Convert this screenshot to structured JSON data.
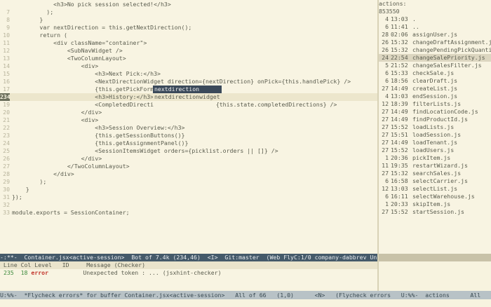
{
  "editor": {
    "lines": [
      {
        "n": "",
        "t": "            <h3>No pick session selected!</h3>"
      },
      {
        "n": "7",
        "t": "          );"
      },
      {
        "n": "8",
        "t": "        }"
      },
      {
        "n": "9",
        "t": "        var nextDirection = this.getNextDirection();"
      },
      {
        "n": "10",
        "t": "        return ("
      },
      {
        "n": "11",
        "t": "            <div className=\"container\">"
      },
      {
        "n": "12",
        "t": "                <SubNavWidget />"
      },
      {
        "n": "13",
        "t": "                <TwoColumnLayout>"
      },
      {
        "n": "14",
        "t": "                    <div>"
      },
      {
        "n": "15",
        "t": "                        <h3>Next Pick:</h3>"
      },
      {
        "n": "16",
        "t": "                        <NextDirectionWidget direction={nextDirection} onPick={this.handlePick} />"
      },
      {
        "n": "17",
        "t": "                        {this.getPickForm(next)"
      },
      {
        "n": "234",
        "t": "                        <h3>History:</h3> next"
      },
      {
        "n": "19",
        "t": "                        <CompletedDirecti                  {this.state.completedDirections} />"
      },
      {
        "n": "20",
        "t": "                    </div>"
      },
      {
        "n": "21",
        "t": "                    <div>"
      },
      {
        "n": "22",
        "t": "                        <h3>Session Overview:</h3>"
      },
      {
        "n": "23",
        "t": "                        {this.getSessionButtons()}"
      },
      {
        "n": "24",
        "t": "                        {this.getAssignmentPanel()}"
      },
      {
        "n": "25",
        "t": "                        <SessionItemsWidget orders={picklist.orders || []} />"
      },
      {
        "n": "26",
        "t": "                    </div>"
      },
      {
        "n": "27",
        "t": "                </TwoColumnLayout>"
      },
      {
        "n": "28",
        "t": "            </div>"
      },
      {
        "n": "29",
        "t": "        );"
      },
      {
        "n": "30",
        "t": "    }"
      },
      {
        "n": "31",
        "t": "});"
      },
      {
        "n": "32",
        "t": ""
      },
      {
        "n": "33",
        "t": "module.exports = SessionContainer;"
      }
    ],
    "current_line": "234"
  },
  "completion": {
    "items": [
      "nextdirection",
      "nextdirectionwidget"
    ],
    "selected": 0
  },
  "sidebar": {
    "header": "actions:",
    "total": "853550",
    "files": [
      {
        "size": "4",
        "time": "13:03",
        "name": "."
      },
      {
        "size": "6",
        "time": "11:41",
        "name": ".."
      },
      {
        "size": "28",
        "time": "02:06",
        "name": "assignUser.js"
      },
      {
        "size": "26",
        "time": "15:32",
        "name": "changeDraftAssignment.js"
      },
      {
        "size": "26",
        "time": "15:32",
        "name": "changePendingPickQuantity.js"
      },
      {
        "size": "24",
        "time": "22:54",
        "name": "changeSalePriority.js"
      },
      {
        "size": "5",
        "time": "21:52",
        "name": "changeSalesFilter.js"
      },
      {
        "size": "6",
        "time": "15:33",
        "name": "checkSale.js"
      },
      {
        "size": "6",
        "time": "18:56",
        "name": "clearDraft.js"
      },
      {
        "size": "27",
        "time": "14:49",
        "name": "createList.js"
      },
      {
        "size": "4",
        "time": "13:03",
        "name": "endSession.js"
      },
      {
        "size": "12",
        "time": "18:39",
        "name": "filterLists.js"
      },
      {
        "size": "27",
        "time": "14:49",
        "name": "findLocationCode.js"
      },
      {
        "size": "27",
        "time": "14:49",
        "name": "findProductId.js"
      },
      {
        "size": "27",
        "time": "15:52",
        "name": "loadLists.js"
      },
      {
        "size": "27",
        "time": "15:51",
        "name": "loadSession.js"
      },
      {
        "size": "27",
        "time": "14:49",
        "name": "loadTenant.js"
      },
      {
        "size": "27",
        "time": "15:52",
        "name": "loadUsers.js"
      },
      {
        "size": "1",
        "time": "20:36",
        "name": "pickItem.js"
      },
      {
        "size": "11",
        "time": "19:35",
        "name": "restartWizard.js"
      },
      {
        "size": "27",
        "time": "15:32",
        "name": "searchSales.js"
      },
      {
        "size": "6",
        "time": "16:58",
        "name": "selectCarrier.js"
      },
      {
        "size": "12",
        "time": "13:03",
        "name": "selectList.js"
      },
      {
        "size": "6",
        "time": "16:11",
        "name": "selectWarehouse.js"
      },
      {
        "size": "1",
        "time": "20:33",
        "name": "skipItem.js"
      },
      {
        "size": "27",
        "time": "15:52",
        "name": "startSession.js"
      }
    ],
    "selected_index": 5
  },
  "modeline": {
    "text": "-:**-  Container.jsx<active-session>  Bot of 7.4k (234,46)  <I>  Git:master  (Web FlyC:1/0 company-dabbrev Un"
  },
  "flycheck": {
    "header": " Line Col Level   ID     Message (Checker)",
    "row": {
      "line": "235",
      "col": "18",
      "level": "error",
      "message": "Unexpected token : ... (jsxhint-checker)"
    }
  },
  "minibuffer": {
    "text": "U:%%-  *Flycheck errors* for buffer Container.jsx<active-session>   All of 66   (1,0)      <N>   (Flycheck errors   U:%%-  actions      All"
  }
}
